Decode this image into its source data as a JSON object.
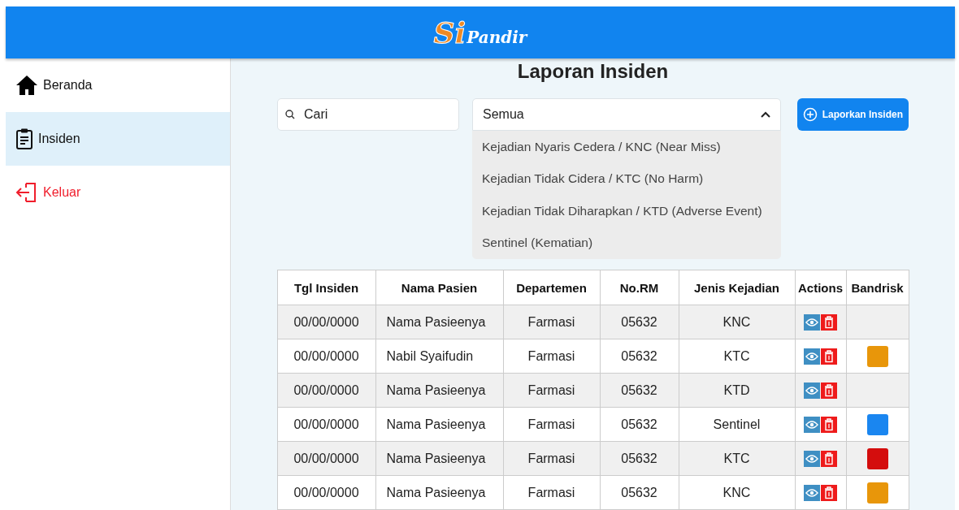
{
  "header": {
    "logo_main": "Si",
    "logo_sub": "Pandir"
  },
  "sidebar": {
    "items": [
      {
        "label": "Beranda",
        "kind": "home",
        "selected": false
      },
      {
        "label": "Insiden",
        "kind": "report",
        "selected": true
      },
      {
        "label": "Keluar",
        "kind": "logout",
        "selected": false
      }
    ]
  },
  "page_title": "Laporan Insiden",
  "search": {
    "placeholder": "Cari"
  },
  "filter": {
    "value": "Semua",
    "expanded": true,
    "options": [
      "Kejadian Nyaris Cedera / KNC (Near Miss)",
      "Kejadian Tidak Cidera / KTC (No Harm)",
      "Kejadian Tidak Diharapkan / KTD (Adverse Event)",
      "Sentinel (Kematian)"
    ]
  },
  "report_button": "Laporkan Insiden",
  "table": {
    "columns": [
      "Tgl Insiden",
      "Nama Pasien",
      "Departemen",
      "No.RM",
      "Jenis Kejadian",
      "Actions",
      "Bandrisk"
    ],
    "rows": [
      {
        "date": "00/00/0000",
        "name": "Nama Pasieenya",
        "department": "Farmasi",
        "rm": "05632",
        "type": "KNC",
        "color": null
      },
      {
        "date": "00/00/0000",
        "name": "Nabil Syaifudin",
        "department": "Farmasi",
        "rm": "05632",
        "type": "KTC",
        "color": "#e8960a"
      },
      {
        "date": "00/00/0000",
        "name": "Nama Pasieenya",
        "department": "Farmasi",
        "rm": "05632",
        "type": "KTD",
        "color": null
      },
      {
        "date": "00/00/0000",
        "name": "Nama Pasieenya",
        "department": "Farmasi",
        "rm": "05632",
        "type": "Sentinel",
        "color": "#1a86f0"
      },
      {
        "date": "00/00/0000",
        "name": "Nama Pasieenya",
        "department": "Farmasi",
        "rm": "05632",
        "type": "KTC",
        "color": "#d40d0d"
      },
      {
        "date": "00/00/0000",
        "name": "Nama Pasieenya",
        "department": "Farmasi",
        "rm": "05632",
        "type": "KNC",
        "color": "#e8960a"
      }
    ]
  }
}
